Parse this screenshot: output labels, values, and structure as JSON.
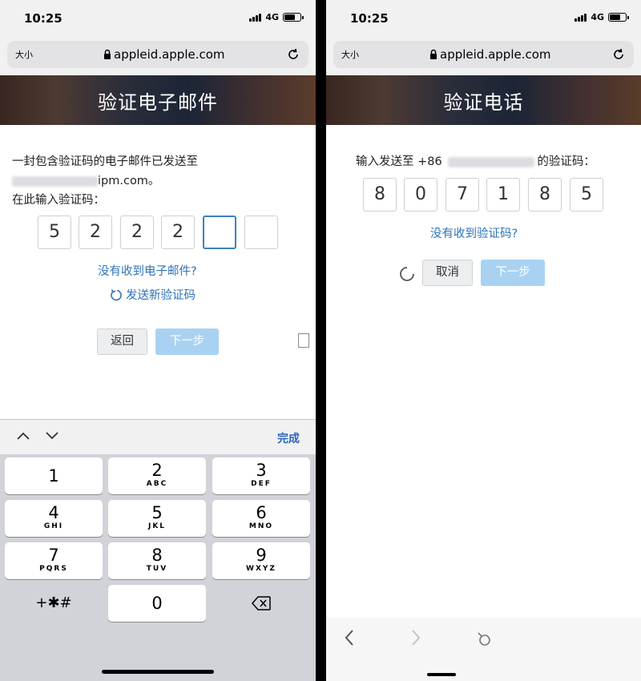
{
  "left": {
    "status": {
      "time": "10:25",
      "network": "4G"
    },
    "browser": {
      "text_size": "大小",
      "url": "appleid.apple.com"
    },
    "banner": {
      "title": "验证电子邮件"
    },
    "message": {
      "line1": "一封包含验证码的电子邮件已发送至",
      "email_suffix": "ipm.com。",
      "line3": "在此输入验证码："
    },
    "code_digits": [
      "5",
      "2",
      "2",
      "2",
      "",
      ""
    ],
    "no_email_link": "没有收到电子邮件?",
    "resend_link": "发送新验证码",
    "buttons": {
      "back": "返回",
      "next": "下一步"
    },
    "keyboard": {
      "done": "完成",
      "keys": [
        {
          "num": "1",
          "letters": ""
        },
        {
          "num": "2",
          "letters": "ABC"
        },
        {
          "num": "3",
          "letters": "DEF"
        },
        {
          "num": "4",
          "letters": "GHI"
        },
        {
          "num": "5",
          "letters": "JKL"
        },
        {
          "num": "6",
          "letters": "MNO"
        },
        {
          "num": "7",
          "letters": "PQRS"
        },
        {
          "num": "8",
          "letters": "TUV"
        },
        {
          "num": "9",
          "letters": "WXYZ"
        }
      ],
      "symbols_key": "+✱#",
      "zero_key": "0"
    }
  },
  "right": {
    "status": {
      "time": "10:25",
      "network": "4G"
    },
    "browser": {
      "text_size": "大小",
      "url": "appleid.apple.com"
    },
    "banner": {
      "title": "验证电话"
    },
    "message": {
      "prefix": "输入发送至 +86",
      "suffix": "的验证码："
    },
    "code_digits": [
      "8",
      "0",
      "7",
      "1",
      "8",
      "5"
    ],
    "no_code_link": "没有收到验证码?",
    "buttons": {
      "cancel": "取消",
      "next": "下一步"
    }
  },
  "colors": {
    "link": "#2e73b8",
    "focus": "#3d7fc7",
    "disabled_button": "#a9d2f2"
  }
}
